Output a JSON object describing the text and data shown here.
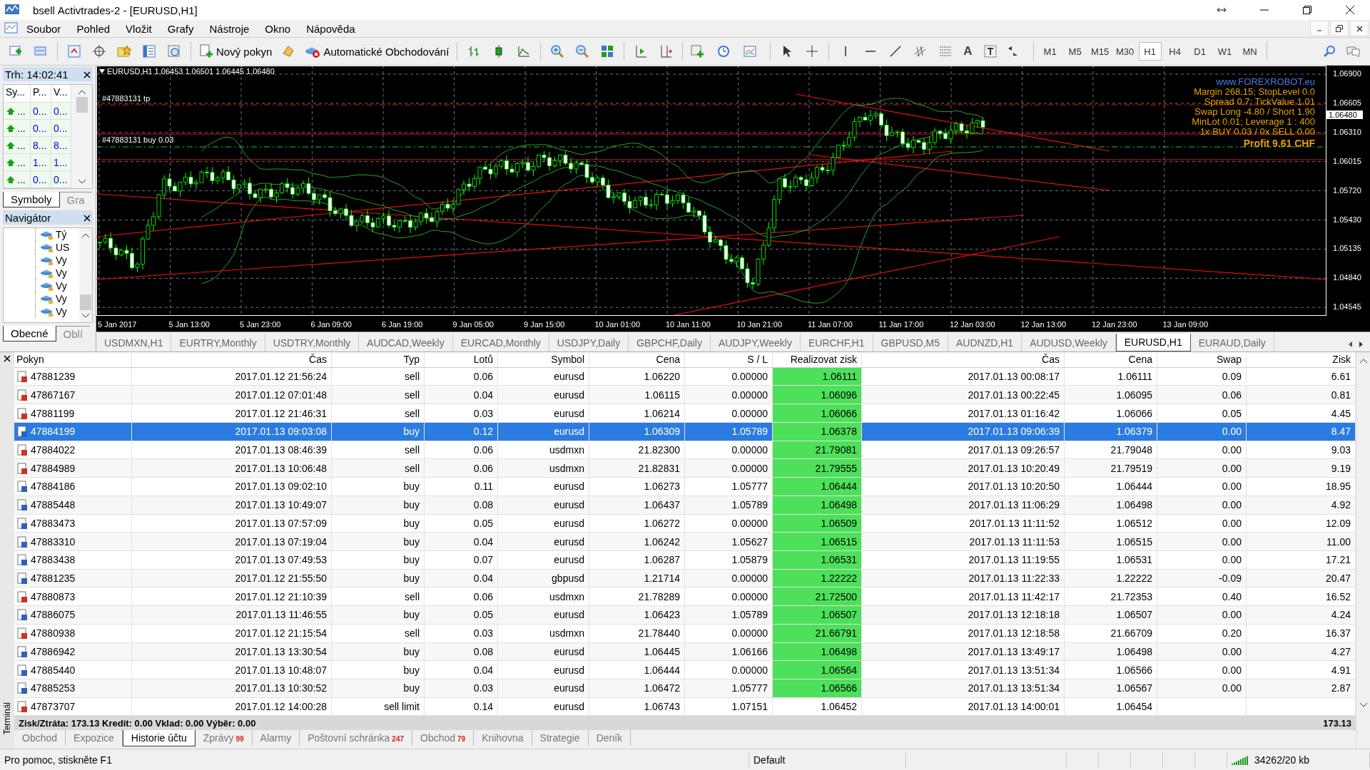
{
  "window": {
    "app_label": "bsell",
    "title": "Activtrades-2 - [EURUSD,H1]"
  },
  "menu": [
    "Soubor",
    "Pohled",
    "Vložit",
    "Grafy",
    "Nástroje",
    "Okno",
    "Nápověda"
  ],
  "toolbar": {
    "new_order": "Nový pokyn",
    "autotrading": "Automatické Obchodování",
    "text_tool": "A",
    "timeframes": [
      {
        "label": "M1",
        "selected": false
      },
      {
        "label": "M5",
        "selected": false
      },
      {
        "label": "M15",
        "selected": false
      },
      {
        "label": "M30",
        "selected": false
      },
      {
        "label": "H1",
        "selected": true
      },
      {
        "label": "H4",
        "selected": false
      },
      {
        "label": "D1",
        "selected": false
      },
      {
        "label": "W1",
        "selected": false
      },
      {
        "label": "MN",
        "selected": false
      }
    ]
  },
  "market_watch": {
    "title": "Trh: 14:02:41",
    "columns": [
      "Sy...",
      "P...",
      "V..."
    ],
    "rows": [
      [
        "...",
        "0...",
        "0..."
      ],
      [
        "...",
        "0...",
        "0..."
      ],
      [
        "...",
        "8...",
        "8..."
      ],
      [
        "...",
        "1...",
        "1..."
      ],
      [
        "...",
        "0...",
        "0..."
      ]
    ],
    "tabs": [
      {
        "label": "Symboly",
        "selected": true
      },
      {
        "label": "Gra",
        "selected": false
      }
    ]
  },
  "navigator": {
    "title": "Navigátor",
    "items": [
      "Tý",
      "US",
      "Vy",
      "Vy",
      "Vy",
      "Vy",
      "Vy"
    ],
    "tabs": [
      {
        "label": "Obecné",
        "selected": true
      },
      {
        "label": "Oblí",
        "selected": false
      }
    ]
  },
  "chart": {
    "header": "EURUSD,H1 1.06453 1.06501 1.06445 1.06480",
    "tp_label": "#47883131 tp",
    "order_label": "#47883131 buy 0.03",
    "site": "www.FOREXROBOT.eu",
    "info": [
      "Margin 268.15; StopLevel 0.0",
      "Spread 0.7; TickValue 1.01",
      "Swap Long -4.80 / Short 1.90",
      "MinLot 0.01; Leverage 1 : 400",
      "1x BUY 0.03 / 0x SELL 0.00"
    ],
    "profit": "Profit 9.61 CHF",
    "price_labels": [
      "1.06900",
      "1.06605",
      "1.06310",
      "1.06015",
      "1.05720",
      "1.05430",
      "1.05135",
      "1.04840",
      "1.04545"
    ],
    "current_price": "1.06480",
    "time_labels": [
      "5 Jan 2017",
      "5 Jan 13:00",
      "5 Jan 23:00",
      "6 Jan 09:00",
      "6 Jan 19:00",
      "9 Jan 05:00",
      "9 Jan 15:00",
      "10 Jan 01:00",
      "10 Jan 11:00",
      "10 Jan 21:00",
      "11 Jan 07:00",
      "11 Jan 17:00",
      "12 Jan 03:00",
      "12 Jan 13:00",
      "12 Jan 23:00",
      "13 Jan 09:00"
    ]
  },
  "chart_tabs": [
    {
      "label": "USDMXN,H1",
      "selected": false
    },
    {
      "label": "EURTRY,Monthly",
      "selected": false
    },
    {
      "label": "USDTRY,Monthly",
      "selected": false
    },
    {
      "label": "AUDCAD,Weekly",
      "selected": false
    },
    {
      "label": "EURCAD,Monthly",
      "selected": false
    },
    {
      "label": "USDJPY,Daily",
      "selected": false
    },
    {
      "label": "GBPCHF,Daily",
      "selected": false
    },
    {
      "label": "AUDJPY,Weekly",
      "selected": false
    },
    {
      "label": "EURCHF,H1",
      "selected": false
    },
    {
      "label": "GBPUSD,M5",
      "selected": false
    },
    {
      "label": "AUDNZD,H1",
      "selected": false
    },
    {
      "label": "AUDUSD,Weekly",
      "selected": false
    },
    {
      "label": "EURUSD,H1",
      "selected": true
    },
    {
      "label": "EURAUD,Daily",
      "selected": false
    }
  ],
  "terminal": {
    "side_label": "Terminál",
    "columns": [
      "Pokyn",
      "Čas",
      "Typ",
      "Lotů",
      "Symbol",
      "Cena",
      "S / L",
      "Realizovat zisk",
      "Čas",
      "Cena",
      "Swap",
      "Zisk"
    ],
    "rows": [
      {
        "kind": "sell",
        "selected": false,
        "cells": [
          "47881239",
          "2017.01.12 21:56:24",
          "sell",
          "0.06",
          "eurusd",
          "1.06220",
          "0.00000",
          "1.06111",
          "2017.01.13 00:08:17",
          "1.06111",
          "0.09",
          "6.61"
        ]
      },
      {
        "kind": "sell",
        "selected": false,
        "cells": [
          "47867167",
          "2017.01.12 07:01:48",
          "sell",
          "0.04",
          "eurusd",
          "1.06115",
          "0.00000",
          "1.06096",
          "2017.01.13 00:22:45",
          "1.06095",
          "0.06",
          "0.81"
        ]
      },
      {
        "kind": "sell",
        "selected": false,
        "cells": [
          "47881199",
          "2017.01.12 21:46:31",
          "sell",
          "0.03",
          "eurusd",
          "1.06214",
          "0.00000",
          "1.06066",
          "2017.01.13 01:16:42",
          "1.06066",
          "0.05",
          "4.45"
        ]
      },
      {
        "kind": "buy",
        "selected": true,
        "cells": [
          "47884199",
          "2017.01.13 09:03:08",
          "buy",
          "0.12",
          "eurusd",
          "1.06309",
          "1.05789",
          "1.06378",
          "2017.01.13 09:06:39",
          "1.06379",
          "0.00",
          "8.47"
        ]
      },
      {
        "kind": "sell",
        "selected": false,
        "cells": [
          "47884022",
          "2017.01.13 08:46:39",
          "sell",
          "0.06",
          "usdmxn",
          "21.82300",
          "0.00000",
          "21.79081",
          "2017.01.13 09:26:57",
          "21.79048",
          "0.00",
          "9.03"
        ]
      },
      {
        "kind": "sell",
        "selected": false,
        "cells": [
          "47884989",
          "2017.01.13 10:06:48",
          "sell",
          "0.06",
          "usdmxn",
          "21.82831",
          "0.00000",
          "21.79555",
          "2017.01.13 10:20:49",
          "21.79519",
          "0.00",
          "9.19"
        ]
      },
      {
        "kind": "buy",
        "selected": false,
        "cells": [
          "47884186",
          "2017.01.13 09:02:10",
          "buy",
          "0.11",
          "eurusd",
          "1.06273",
          "1.05777",
          "1.06444",
          "2017.01.13 10:20:50",
          "1.06444",
          "0.00",
          "18.95"
        ]
      },
      {
        "kind": "buy",
        "selected": false,
        "cells": [
          "47885448",
          "2017.01.13 10:49:07",
          "buy",
          "0.08",
          "eurusd",
          "1.06437",
          "1.05789",
          "1.06498",
          "2017.01.13 11:06:29",
          "1.06498",
          "0.00",
          "4.92"
        ]
      },
      {
        "kind": "buy",
        "selected": false,
        "cells": [
          "47883473",
          "2017.01.13 07:57:09",
          "buy",
          "0.05",
          "eurusd",
          "1.06272",
          "0.00000",
          "1.06509",
          "2017.01.13 11:11:52",
          "1.06512",
          "0.00",
          "12.09"
        ]
      },
      {
        "kind": "buy",
        "selected": false,
        "cells": [
          "47883310",
          "2017.01.13 07:19:04",
          "buy",
          "0.04",
          "eurusd",
          "1.06242",
          "1.05627",
          "1.06515",
          "2017.01.13 11:11:53",
          "1.06515",
          "0.00",
          "11.00"
        ]
      },
      {
        "kind": "buy",
        "selected": false,
        "cells": [
          "47883438",
          "2017.01.13 07:49:53",
          "buy",
          "0.07",
          "eurusd",
          "1.06287",
          "1.05879",
          "1.06531",
          "2017.01.13 11:19:55",
          "1.06531",
          "0.00",
          "17.21"
        ]
      },
      {
        "kind": "buy",
        "selected": false,
        "cells": [
          "47881235",
          "2017.01.12 21:55:50",
          "buy",
          "0.04",
          "gbpusd",
          "1.21714",
          "0.00000",
          "1.22222",
          "2017.01.13 11:22:33",
          "1.22222",
          "-0.09",
          "20.47"
        ]
      },
      {
        "kind": "sell",
        "selected": false,
        "cells": [
          "47880873",
          "2017.01.12 21:10:39",
          "sell",
          "0.06",
          "usdmxn",
          "21.78289",
          "0.00000",
          "21.72500",
          "2017.01.13 11:42:17",
          "21.72353",
          "0.40",
          "16.52"
        ]
      },
      {
        "kind": "buy",
        "selected": false,
        "cells": [
          "47886075",
          "2017.01.13 11:46:55",
          "buy",
          "0.05",
          "eurusd",
          "1.06423",
          "1.05789",
          "1.06507",
          "2017.01.13 12:18:18",
          "1.06507",
          "0.00",
          "4.24"
        ]
      },
      {
        "kind": "sell",
        "selected": false,
        "cells": [
          "47880938",
          "2017.01.12 21:15:54",
          "sell",
          "0.03",
          "usdmxn",
          "21.78440",
          "0.00000",
          "21.66791",
          "2017.01.13 12:18:58",
          "21.66709",
          "0.20",
          "16.37"
        ]
      },
      {
        "kind": "buy",
        "selected": false,
        "cells": [
          "47886942",
          "2017.01.13 13:30:54",
          "buy",
          "0.08",
          "eurusd",
          "1.06445",
          "1.06166",
          "1.06498",
          "2017.01.13 13:49:17",
          "1.06498",
          "0.00",
          "4.27"
        ]
      },
      {
        "kind": "buy",
        "selected": false,
        "cells": [
          "47885440",
          "2017.01.13 10:48:07",
          "buy",
          "0.04",
          "eurusd",
          "1.06444",
          "0.00000",
          "1.06564",
          "2017.01.13 13:51:34",
          "1.06566",
          "0.00",
          "4.91"
        ]
      },
      {
        "kind": "buy",
        "selected": false,
        "cells": [
          "47885253",
          "2017.01.13 10:30:52",
          "buy",
          "0.03",
          "eurusd",
          "1.06472",
          "1.05777",
          "1.06566",
          "2017.01.13 13:51:34",
          "1.06567",
          "0.00",
          "2.87"
        ]
      },
      {
        "kind": "pending",
        "selected": false,
        "cells": [
          "47873707",
          "2017.01.12 14:00:28",
          "sell limit",
          "0.14",
          "eurusd",
          "1.06743",
          "1.07151",
          "1.06452",
          "2017.01.13 14:00:01",
          "1.06454"
        ]
      }
    ],
    "summary": "Zisk/Ztráta: 173.13  Kredit: 0.00  Vklad: 0.00  Výběr: 0.00",
    "total": "173.13",
    "tabs": [
      {
        "label": "Obchod",
        "selected": false
      },
      {
        "label": "Expozice",
        "selected": false
      },
      {
        "label": "Historie účtu",
        "selected": true
      },
      {
        "label": "Zprávy",
        "badge": "99",
        "selected": false
      },
      {
        "label": "Alarmy",
        "selected": false
      },
      {
        "label": "Poštovní schránka",
        "badge": "247",
        "selected": false
      },
      {
        "label": "Obchod",
        "badge": "79",
        "selected": false
      },
      {
        "label": "Knihovna",
        "selected": false
      },
      {
        "label": "Strategie",
        "selected": false
      },
      {
        "label": "Deník",
        "selected": false
      }
    ]
  },
  "status_bar": {
    "help": "Pro pomoc, stiskněte F1",
    "profile": "Default",
    "traffic": "34262/20 kb"
  }
}
